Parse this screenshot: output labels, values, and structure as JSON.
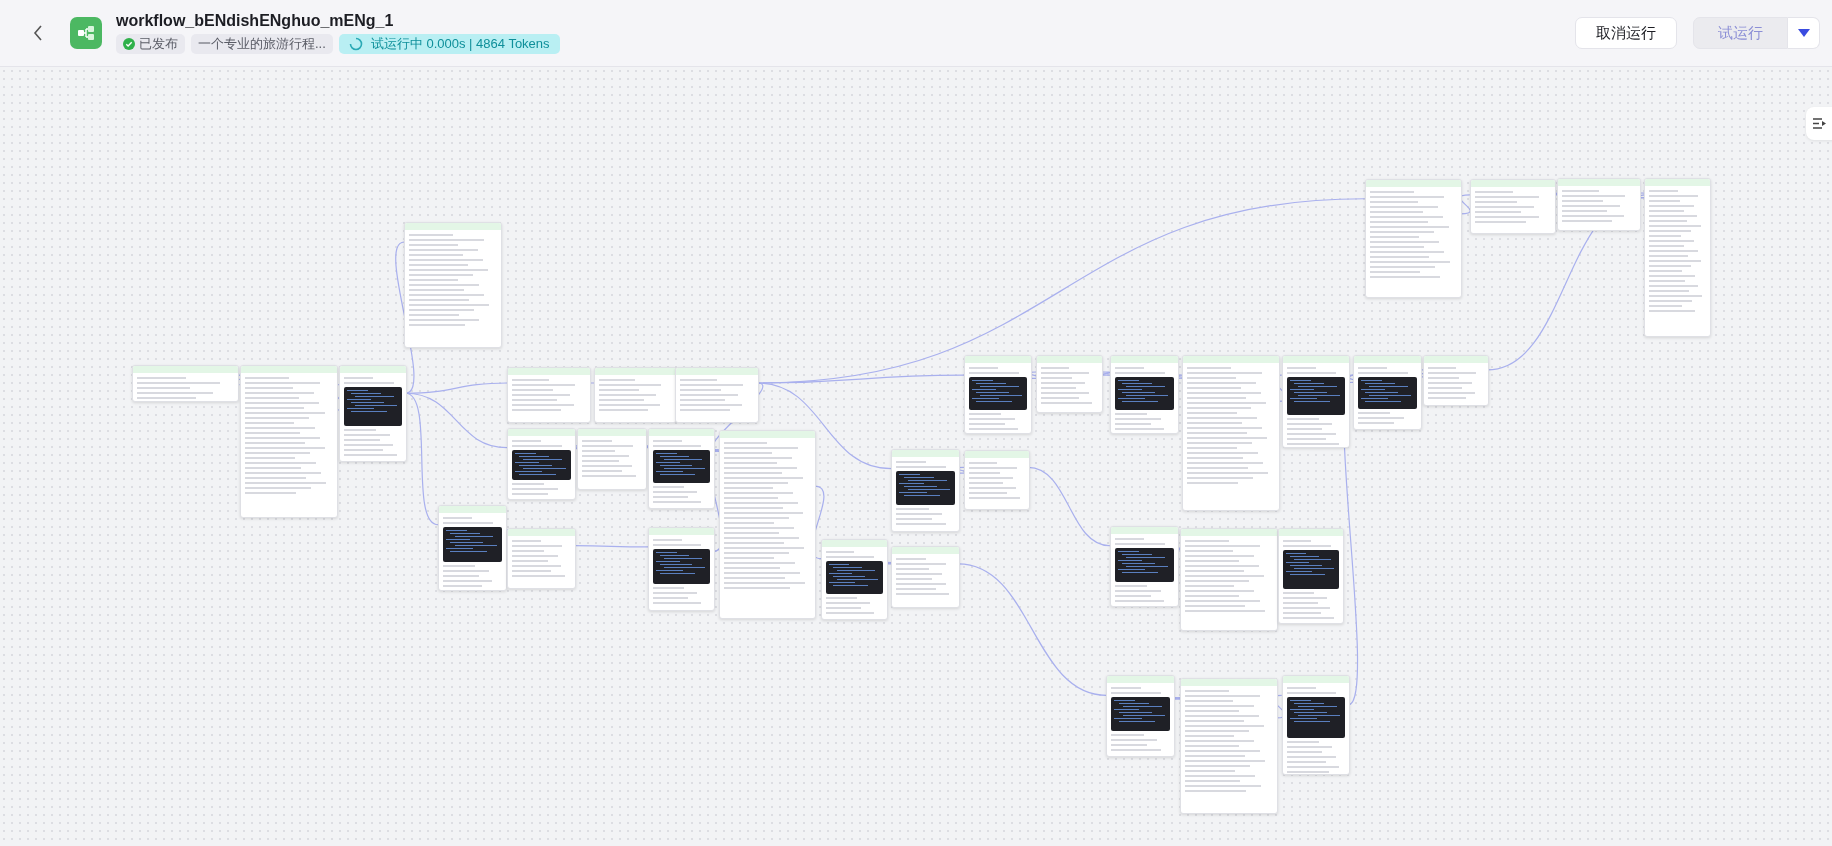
{
  "header": {
    "title": "workflow_bENdishENghuo_mENg_1",
    "status": {
      "label": "已发布",
      "published": true
    },
    "description": "一个专业的旅游行程...",
    "run_status": {
      "label": "试运行中 0.000s | 4864 Tokens",
      "running": true
    }
  },
  "actions": [
    {
      "label": "取消运行",
      "kind": "secondary",
      "disabled": false
    },
    {
      "label": "试运行",
      "kind": "primary",
      "disabled": true
    }
  ]
}
